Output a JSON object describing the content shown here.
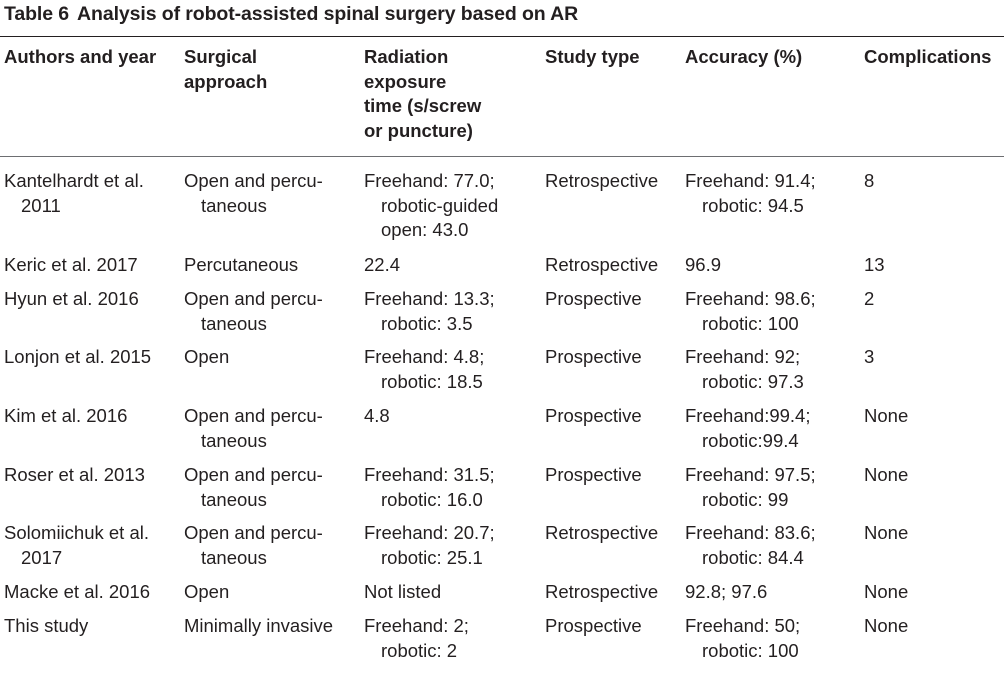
{
  "table": {
    "label": "Table 6",
    "title": "Analysis of robot-assisted spinal surgery based on AR",
    "headers": [
      [
        "Authors and year"
      ],
      [
        "Surgical",
        "approach"
      ],
      [
        "Radiation",
        "exposure",
        "time (s/screw",
        "or puncture)"
      ],
      [
        "Study type"
      ],
      [
        "Accuracy (%)"
      ],
      [
        "Complications"
      ]
    ],
    "rows": [
      [
        [
          "Kantelhardt et al.",
          "2011"
        ],
        [
          "Open and percu-",
          "taneous"
        ],
        [
          "Freehand: 77.0;",
          "robotic-guided",
          "open: 43.0"
        ],
        [
          "Retrospective"
        ],
        [
          "Freehand: 91.4;",
          "robotic: 94.5"
        ],
        [
          "8"
        ]
      ],
      [
        [
          "Keric et al. 2017"
        ],
        [
          "Percutaneous"
        ],
        [
          "22.4"
        ],
        [
          "Retrospective"
        ],
        [
          "96.9"
        ],
        [
          "13"
        ]
      ],
      [
        [
          "Hyun et al. 2016"
        ],
        [
          "Open and percu-",
          "taneous"
        ],
        [
          "Freehand: 13.3;",
          "robotic: 3.5"
        ],
        [
          "Prospective"
        ],
        [
          "Freehand: 98.6;",
          "robotic: 100"
        ],
        [
          "2"
        ]
      ],
      [
        [
          "Lonjon et al. 2015"
        ],
        [
          "Open"
        ],
        [
          "Freehand: 4.8;",
          "robotic: 18.5"
        ],
        [
          "Prospective"
        ],
        [
          "Freehand: 92;",
          "robotic: 97.3"
        ],
        [
          "3"
        ]
      ],
      [
        [
          "Kim et al. 2016"
        ],
        [
          "Open and percu-",
          "taneous"
        ],
        [
          "4.8"
        ],
        [
          "Prospective"
        ],
        [
          "Freehand:99.4;",
          "robotic:99.4"
        ],
        [
          "None"
        ]
      ],
      [
        [
          "Roser et al. 2013"
        ],
        [
          "Open and percu-",
          "taneous"
        ],
        [
          "Freehand: 31.5;",
          "robotic: 16.0"
        ],
        [
          "Prospective"
        ],
        [
          "Freehand: 97.5;",
          "robotic: 99"
        ],
        [
          "None"
        ]
      ],
      [
        [
          "Solomiichuk et al.",
          "2017"
        ],
        [
          "Open and percu-",
          "taneous"
        ],
        [
          "Freehand: 20.7;",
          "robotic: 25.1"
        ],
        [
          "Retrospective"
        ],
        [
          "Freehand: 83.6;",
          "robotic: 84.4"
        ],
        [
          "None"
        ]
      ],
      [
        [
          "Macke et al. 2016"
        ],
        [
          "Open"
        ],
        [
          "Not listed"
        ],
        [
          "Retrospective"
        ],
        [
          "92.8; 97.6"
        ],
        [
          "None"
        ]
      ],
      [
        [
          "This study"
        ],
        [
          "Minimally invasive"
        ],
        [
          "Freehand: 2;",
          "robotic: 2"
        ],
        [
          "Prospective"
        ],
        [
          "Freehand: 50;",
          "robotic: 100"
        ],
        [
          "None"
        ]
      ]
    ]
  }
}
